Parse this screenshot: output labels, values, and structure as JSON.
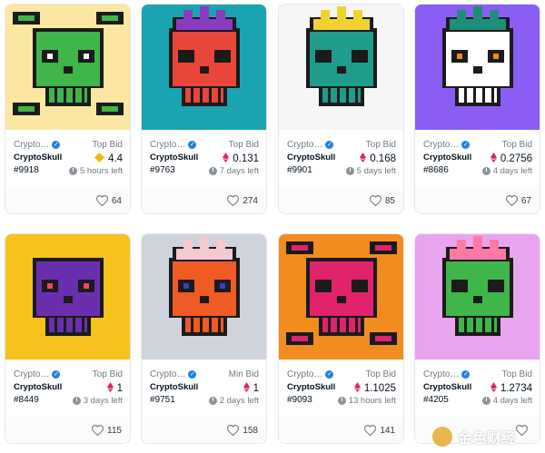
{
  "cards": [
    {
      "collection": "CryptoSkull",
      "collection_short": "Crypto…",
      "name": "CryptoSkull",
      "token": "#9918",
      "bid_label": "Top Bid",
      "price": "4.4",
      "currency": "WETH",
      "time_left": "5 hours left",
      "likes": "64"
    },
    {
      "collection": "CryptoSkull",
      "collection_short": "Crypto…",
      "name": "CryptoSkull",
      "token": "#9763",
      "bid_label": "Top Bid",
      "price": "0.131",
      "currency": "ETH",
      "time_left": "7 days left",
      "likes": "274"
    },
    {
      "collection": "CryptoSkull",
      "collection_short": "Crypto…",
      "name": "CryptoSkull",
      "token": "#9901",
      "bid_label": "Top Bid",
      "price": "0.168",
      "currency": "ETH",
      "time_left": "5 days left",
      "likes": "85"
    },
    {
      "collection": "CryptoSkull",
      "collection_short": "Crypto…",
      "name": "CryptoSkull",
      "token": "#8686",
      "bid_label": "Top Bid",
      "price": "0.2756",
      "currency": "ETH",
      "time_left": "4 days left",
      "likes": "67"
    },
    {
      "collection": "CryptoSkull",
      "collection_short": "Crypto…",
      "name": "CryptoSkull",
      "token": "#8449",
      "bid_label": "Top Bid",
      "price": "1",
      "currency": "ETH",
      "time_left": "3 days left",
      "likes": "115"
    },
    {
      "collection": "CryptoSkull",
      "collection_short": "Crypto…",
      "name": "CryptoSkull",
      "token": "#9751",
      "bid_label": "Min Bid",
      "price": "1",
      "currency": "ETH",
      "time_left": "2 days left",
      "likes": "158"
    },
    {
      "collection": "CryptoSkull",
      "collection_short": "Crypto…",
      "name": "CryptoSkull",
      "token": "#9093",
      "bid_label": "Top Bid",
      "price": "1.1025",
      "currency": "ETH",
      "time_left": "13 hours left",
      "likes": "141"
    },
    {
      "collection": "CryptoSkull",
      "collection_short": "Crypto…",
      "name": "CryptoSkull",
      "token": "#4205",
      "bid_label": "Top Bid",
      "price": "1.2734",
      "currency": "ETH",
      "time_left": "4 days left",
      "likes": ""
    }
  ],
  "art": [
    {
      "bg": "#fbe7a2",
      "skull": "#3fb54a",
      "hair": "none",
      "bones": true,
      "eyes": "#ffffff"
    },
    {
      "bg": "#1aa3b0",
      "skull": "#e8463a",
      "hair": "#8a3bbf",
      "bones": false,
      "eyes": "#1a1a1a"
    },
    {
      "bg": "#f6f6f6",
      "skull": "#1f9c8c",
      "hair": "#f0d231",
      "bones": false,
      "eyes": "#1a1a1a"
    },
    {
      "bg": "#8a5ef5",
      "skull": "#ffffff",
      "hair": "#1e8f77",
      "bones": false,
      "eyes": "#f08a1c"
    },
    {
      "bg": "#f7c21c",
      "skull": "#6a2fae",
      "hair": "none",
      "bones": false,
      "eyes": "#ff3f6a"
    },
    {
      "bg": "#cfd3dc",
      "skull": "#f05a24",
      "hair": "#f5c9cf",
      "bones": false,
      "eyes": "#3b3bd0"
    },
    {
      "bg": "#f28c1e",
      "skull": "#e0236b",
      "hair": "none",
      "bones": true,
      "eyes": "#1a1a1a"
    },
    {
      "bg": "#e8a4ef",
      "skull": "#3fb54a",
      "hair": "#ff7aa3",
      "bones": false,
      "eyes": "#1a1a1a"
    }
  ],
  "colors": {
    "accent": "#2081e2",
    "weth": "#f0b90b",
    "eth": "#e0236b"
  },
  "icons": {
    "verified": "verified-badge-icon",
    "clock": "clock-icon",
    "heart": "heart-icon",
    "eth": "eth-icon",
    "weth": "weth-icon"
  },
  "watermark": {
    "text": "金色财经"
  }
}
